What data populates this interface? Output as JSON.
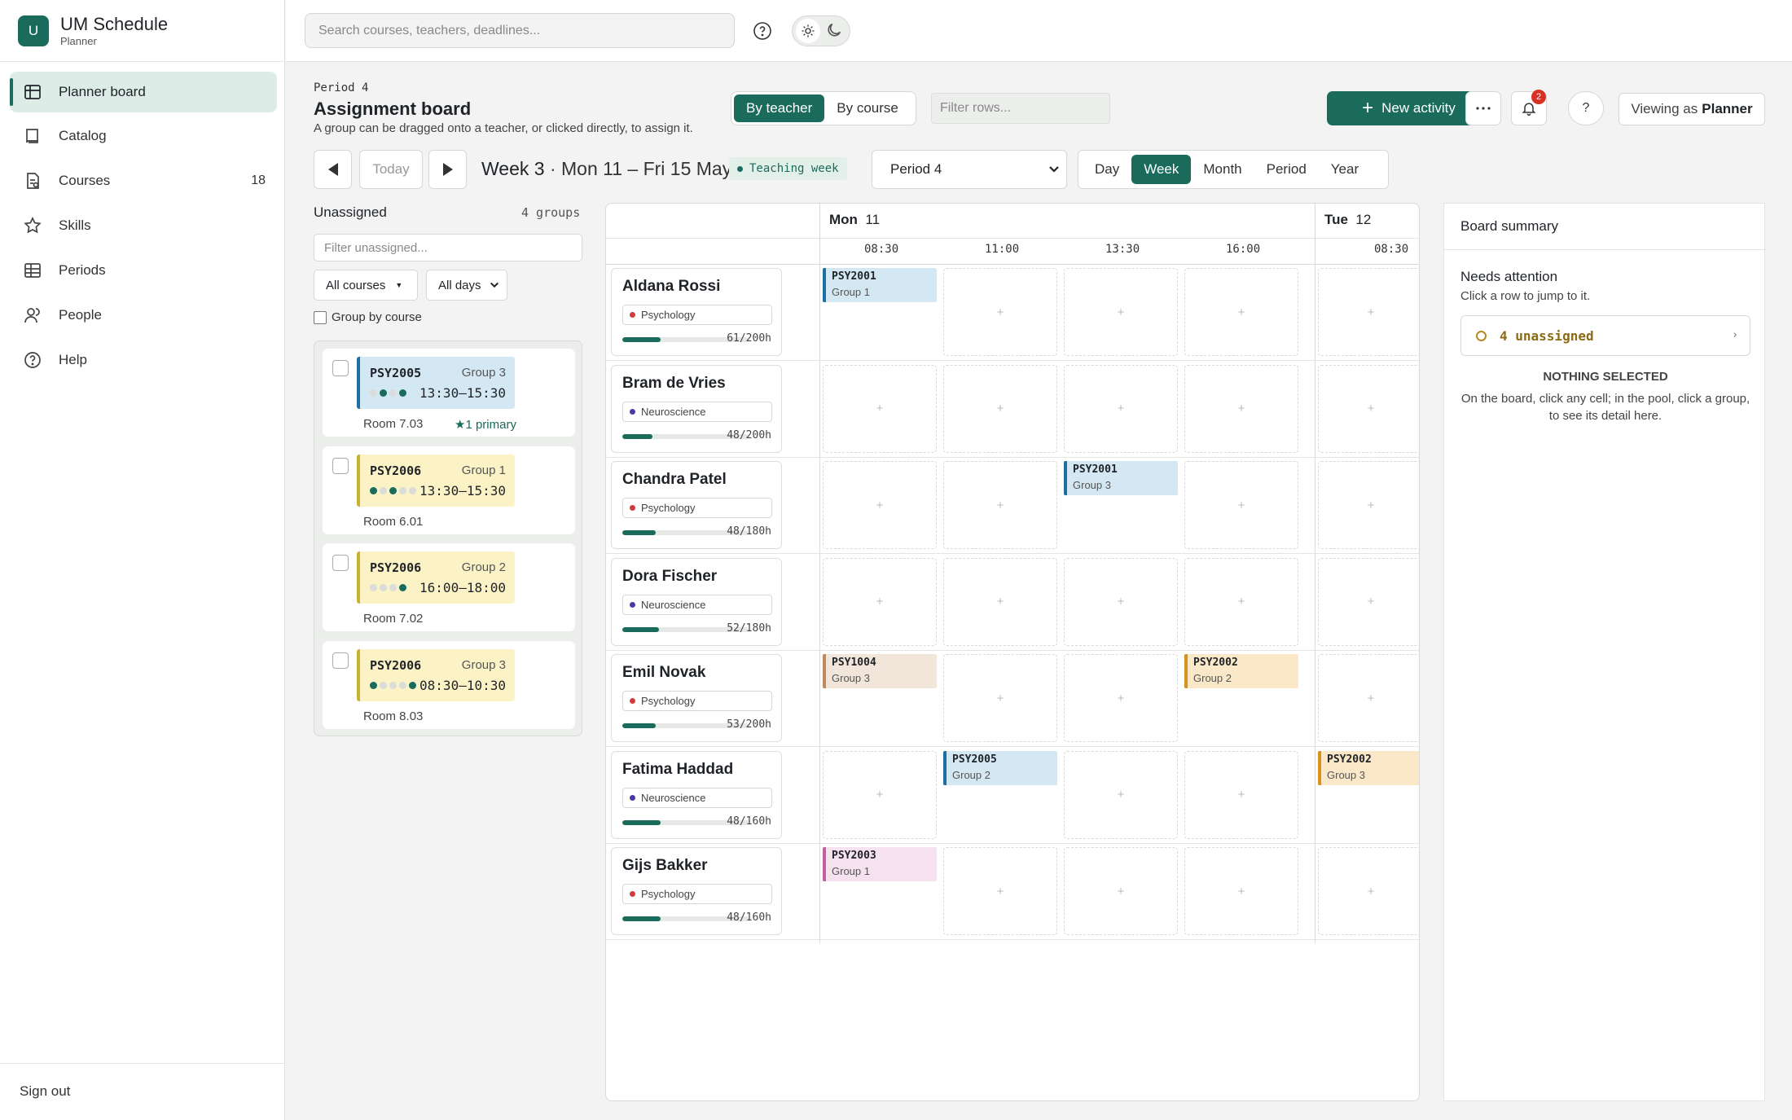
{
  "app": {
    "title": "UM Schedule",
    "subtitle": "Planner",
    "logo_letter": "U"
  },
  "sidebar": {
    "items": [
      {
        "label": "Planner board",
        "icon": "grid-board-icon",
        "active": true
      },
      {
        "label": "Catalog",
        "icon": "book-icon"
      },
      {
        "label": "Courses",
        "icon": "document-icon",
        "count": "18"
      },
      {
        "label": "Skills",
        "icon": "star-icon"
      },
      {
        "label": "Periods",
        "icon": "table-icon"
      },
      {
        "label": "People",
        "icon": "people-icon"
      },
      {
        "label": "Help",
        "icon": "help-circle-icon"
      }
    ],
    "sign_out": "Sign out"
  },
  "topbar": {
    "search_placeholder": "Search courses, teachers, deadlines..."
  },
  "header": {
    "period": "Period 4",
    "title": "Assignment board",
    "hint": "A group can be dragged onto a teacher, or clicked directly, to assign it.",
    "view_toggle": [
      "By teacher",
      "By course"
    ],
    "view_active": "By teacher",
    "filter_rows_placeholder": "Filter rows...",
    "new_activity": "New activity",
    "notifications_count": "2",
    "help_label": "?",
    "viewing_as_prefix": "Viewing as",
    "viewing_as_role": "Planner"
  },
  "navigation": {
    "today": "Today",
    "week_label": "Week 3",
    "week_range": "Mon 11 – Fri 15 May",
    "week_type": "Teaching week",
    "period_select": "Period 4",
    "ranges": [
      "Day",
      "Week",
      "Month",
      "Period",
      "Year"
    ],
    "range_active": "Week"
  },
  "unassigned": {
    "title": "Unassigned",
    "count": "4 groups",
    "filter_placeholder": "Filter unassigned...",
    "course_filter": "All courses",
    "day_filter": "All days",
    "group_by_course": "Group by course",
    "items": [
      {
        "code": "PSY2005",
        "group": "Group 3",
        "time": "13:30–15:30",
        "room": "Room 7.03",
        "primary": "★1 primary",
        "dots": [
          0,
          1,
          0,
          1
        ]
      },
      {
        "code": "PSY2006",
        "group": "Group 1",
        "time": "13:30–15:30",
        "room": "Room 6.01",
        "primary": "",
        "dots": [
          1,
          0,
          1,
          0,
          0
        ]
      },
      {
        "code": "PSY2006",
        "group": "Group 2",
        "time": "16:00–18:00",
        "room": "Room 7.02",
        "primary": "",
        "dots": [
          0,
          0,
          0,
          1
        ]
      },
      {
        "code": "PSY2006",
        "group": "Group 3",
        "time": "08:30–10:30",
        "room": "Room 8.03",
        "primary": "",
        "dots": [
          1,
          0,
          0,
          0,
          1
        ]
      }
    ]
  },
  "board": {
    "days": [
      {
        "name": "Mon",
        "num": "11",
        "times": [
          "08:30",
          "11:00",
          "13:30",
          "16:00"
        ]
      },
      {
        "name": "Tue",
        "num": "12",
        "times": [
          "08:30"
        ]
      }
    ],
    "empty_cell": "+",
    "teachers": [
      {
        "name": "Aldana Rossi",
        "dept": "Psychology",
        "hours": "61/200h",
        "load": 0.305
      },
      {
        "name": "Bram de Vries",
        "dept": "Neuroscience",
        "hours": "48/200h",
        "load": 0.24
      },
      {
        "name": "Chandra Patel",
        "dept": "Psychology",
        "hours": "48/180h",
        "load": 0.267
      },
      {
        "name": "Dora Fischer",
        "dept": "Neuroscience",
        "hours": "52/180h",
        "load": 0.289
      },
      {
        "name": "Emil Novak",
        "dept": "Psychology",
        "hours": "53/200h",
        "load": 0.265
      },
      {
        "name": "Fatima Haddad",
        "dept": "Neuroscience",
        "hours": "48/160h",
        "load": 0.3
      },
      {
        "name": "Gijs Bakker",
        "dept": "Psychology",
        "hours": "48/160h",
        "load": 0.3
      }
    ],
    "assignments": [
      {
        "row": 0,
        "col": 0,
        "code": "PSY2001",
        "group": "Group 1"
      },
      {
        "row": 2,
        "col": 2,
        "code": "PSY2001",
        "group": "Group 3"
      },
      {
        "row": 4,
        "col": 0,
        "code": "PSY1004",
        "group": "Group 3"
      },
      {
        "row": 4,
        "col": 3,
        "code": "PSY2002",
        "group": "Group 2"
      },
      {
        "row": 5,
        "col": 1,
        "code": "PSY2005",
        "group": "Group 2"
      },
      {
        "row": 5,
        "col": 4,
        "code": "PSY2002",
        "group": "Group 3"
      },
      {
        "row": 6,
        "col": 0,
        "code": "PSY2003",
        "group": "Group 1"
      }
    ]
  },
  "summary": {
    "title": "Board summary",
    "needs_attention": "Needs attention",
    "needs_sub": "Click a row to jump to it.",
    "unassigned_alert": "4 unassigned",
    "nothing_selected": "NOTHING SELECTED",
    "nothing_sub": "On the board, click any cell; in the pool, click a group, to see its detail here."
  },
  "colors": {
    "accent": "#1a6b5b",
    "psychology": "#d33b3b",
    "neuroscience": "#4a3aa8",
    "chip_blue_bg": "#d4e8f3",
    "chip_blue_border": "#1d6fa3",
    "chip_yellow_bg": "#fbf3c6",
    "chip_yellow_border": "#c9b230",
    "chip_tan_bg": "#f2e6da",
    "chip_tan_border": "#c08a5a",
    "chip_orange_bg": "#fae8c8",
    "chip_orange_border": "#d8921e",
    "chip_pink_bg": "#f6e2ef",
    "chip_pink_border": "#c05fa0"
  }
}
